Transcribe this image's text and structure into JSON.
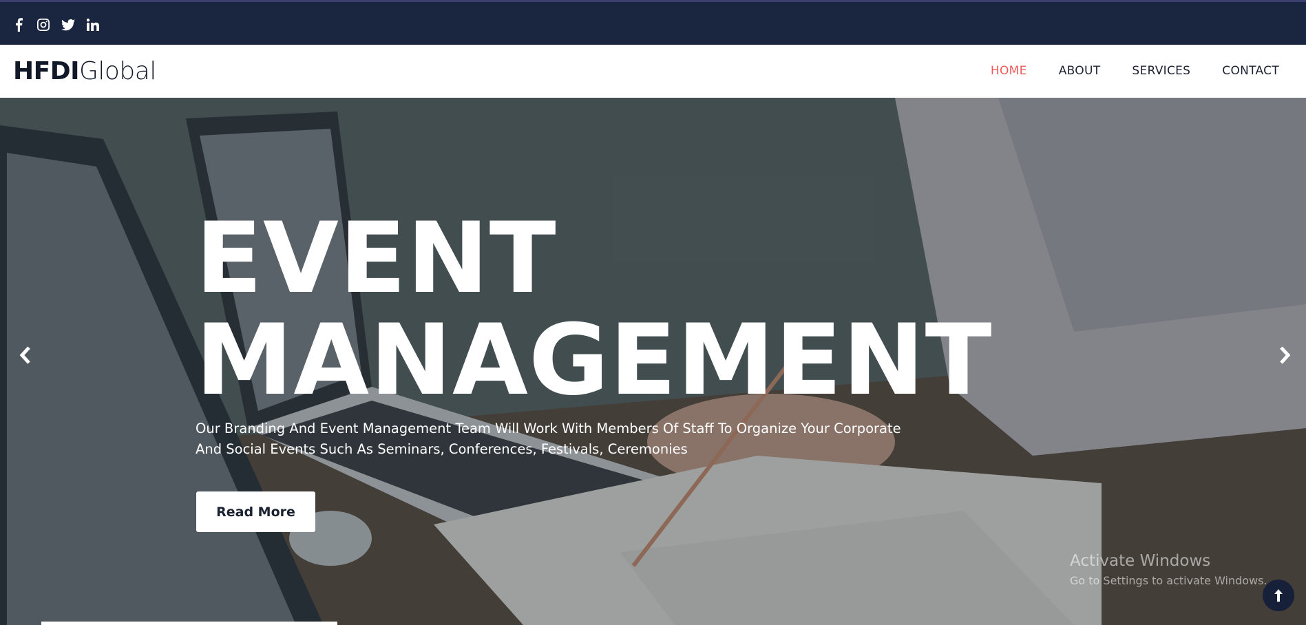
{
  "topbar": {
    "social": [
      {
        "icon": "facebook-icon",
        "label": "Facebook"
      },
      {
        "icon": "instagram-icon",
        "label": "Instagram"
      },
      {
        "icon": "twitter-icon",
        "label": "Twitter"
      },
      {
        "icon": "linkedin-icon",
        "label": "LinkedIn"
      }
    ]
  },
  "navbar": {
    "logo_bold": "HFDI",
    "logo_light": "Global",
    "links": [
      {
        "label": "HOME",
        "active": true
      },
      {
        "label": "ABOUT",
        "active": false
      },
      {
        "label": "SERVICES",
        "active": false
      },
      {
        "label": "CONTACT",
        "active": false
      }
    ]
  },
  "hero": {
    "title_line1": "EVENT",
    "title_line2": "MANAGEMENT",
    "subtitle_line1": "Our Branding And Event Management Team Will Work With Members Of Staff To Organize Your Corporate",
    "subtitle_line2": "And Social Events Such As Seminars, Conferences, Festivals, Ceremonies",
    "cta_label": "Read More"
  },
  "watermark": {
    "line1": "Activate Windows",
    "line2": "Go to Settings to activate Windows."
  },
  "colors": {
    "topbar": "#1a2540",
    "nav_active": "#f05a5a",
    "nav_text": "#1b2130"
  }
}
